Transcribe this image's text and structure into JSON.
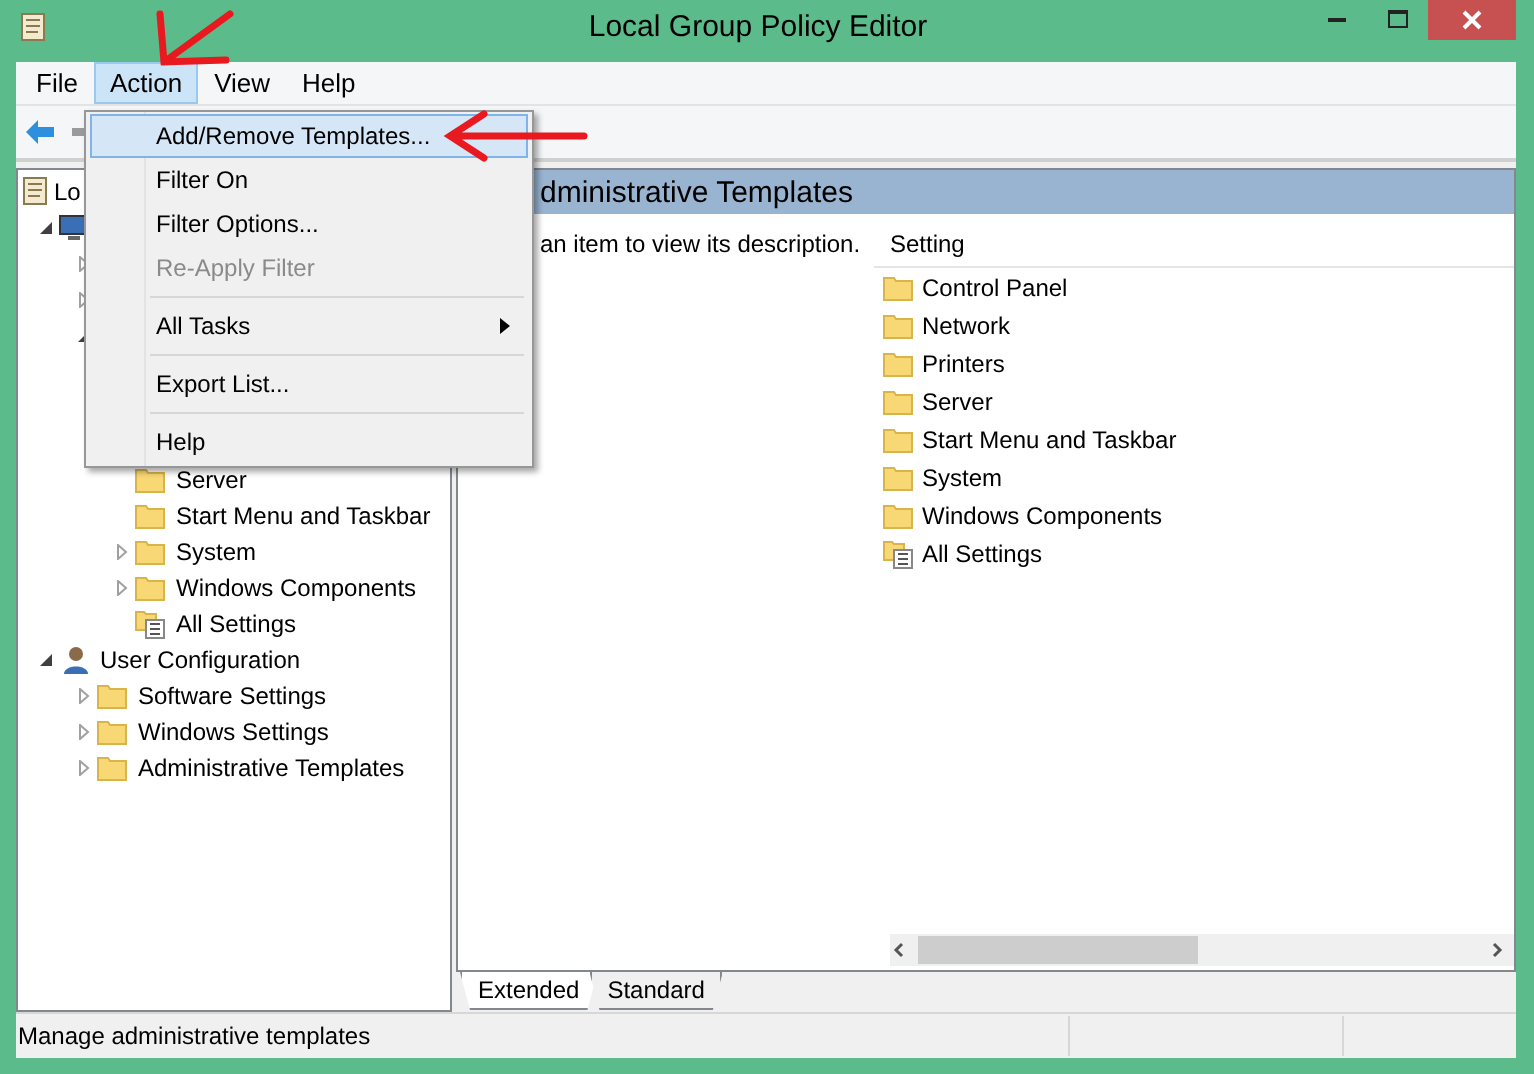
{
  "window": {
    "title": "Local Group Policy Editor"
  },
  "menubar": [
    {
      "label": "File",
      "selected": false
    },
    {
      "label": "Action",
      "selected": true
    },
    {
      "label": "View",
      "selected": false
    },
    {
      "label": "Help",
      "selected": false
    }
  ],
  "tree": [
    {
      "label": "Lo",
      "kind": "policy",
      "children": [
        {
          "kind": "computer",
          "expanded": true,
          "children": [
            {
              "expanded": false
            },
            {
              "expanded": false
            },
            {
              "expanded": true,
              "children": [
                {
                  "label": "Server",
                  "kind": "folder"
                },
                {
                  "label": "Start Menu and Taskbar",
                  "kind": "folder"
                },
                {
                  "label": "System",
                  "kind": "folder",
                  "expanded": false
                },
                {
                  "label": "Windows Components",
                  "kind": "folder",
                  "expanded": false
                },
                {
                  "label": "All Settings",
                  "kind": "settings"
                }
              ]
            }
          ]
        },
        {
          "label": "User Configuration",
          "kind": "user",
          "expanded": true,
          "children": [
            {
              "label": "Software Settings",
              "kind": "folder",
              "expanded": false
            },
            {
              "label": "Windows Settings",
              "kind": "folder",
              "expanded": false
            },
            {
              "label": "Administrative Templates",
              "kind": "folder",
              "expanded": false
            }
          ]
        }
      ]
    }
  ],
  "details": {
    "title": "dministrative Templates",
    "description": "an item to view its description.",
    "column": "Setting",
    "items": [
      {
        "label": "Control Panel",
        "kind": "folder"
      },
      {
        "label": "Network",
        "kind": "folder"
      },
      {
        "label": "Printers",
        "kind": "folder"
      },
      {
        "label": "Server",
        "kind": "folder"
      },
      {
        "label": "Start Menu and Taskbar",
        "kind": "folder"
      },
      {
        "label": "System",
        "kind": "folder"
      },
      {
        "label": "Windows Components",
        "kind": "folder"
      },
      {
        "label": "All Settings",
        "kind": "settings"
      }
    ]
  },
  "view_tabs": [
    {
      "label": "Extended",
      "selected": true
    },
    {
      "label": "Standard",
      "selected": false
    }
  ],
  "status_bar": {
    "text": "Manage administrative templates"
  },
  "action_menu": [
    {
      "kind": "item",
      "label": "Add/Remove Templates...",
      "selected": true,
      "disabled": false
    },
    {
      "kind": "item",
      "label": "Filter On",
      "selected": false,
      "disabled": false
    },
    {
      "kind": "item",
      "label": "Filter Options...",
      "selected": false,
      "disabled": false
    },
    {
      "kind": "item",
      "label": "Re-Apply Filter",
      "selected": false,
      "disabled": true
    },
    {
      "kind": "separator"
    },
    {
      "kind": "submenu",
      "label": "All Tasks",
      "selected": false,
      "disabled": false
    },
    {
      "kind": "separator"
    },
    {
      "kind": "item",
      "label": "Export List...",
      "selected": false,
      "disabled": false
    },
    {
      "kind": "separator"
    },
    {
      "kind": "item",
      "label": "Help",
      "selected": false,
      "disabled": false
    }
  ]
}
